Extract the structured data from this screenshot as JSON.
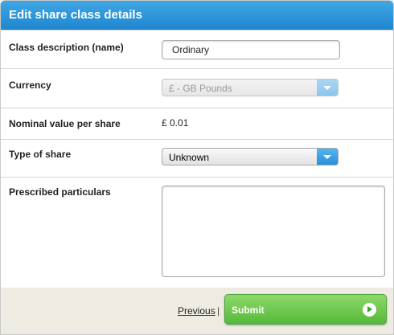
{
  "header": {
    "title": "Edit share class details"
  },
  "form": {
    "class_description": {
      "label": "Class description (name)",
      "value": "Ordinary"
    },
    "currency": {
      "label": "Currency",
      "selected": "£ - GB Pounds",
      "disabled": true
    },
    "nominal_value": {
      "label": "Nominal value per share",
      "value": "£ 0.01"
    },
    "type_of_share": {
      "label": "Type of share",
      "selected": "Unknown"
    },
    "prescribed_particulars": {
      "label": "Prescribed particulars",
      "value": ""
    }
  },
  "footer": {
    "previous_label": "Previous",
    "separator": "|",
    "submit_label": "Submit"
  },
  "colors": {
    "header_blue": "#2a93d8",
    "submit_green": "#6cc74c",
    "footer_bg": "#eeebe3"
  }
}
